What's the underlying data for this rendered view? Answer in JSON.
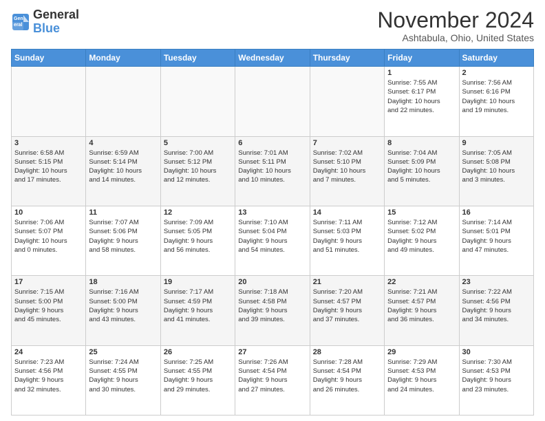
{
  "header": {
    "logo_line1": "General",
    "logo_line2": "Blue",
    "month": "November 2024",
    "location": "Ashtabula, Ohio, United States"
  },
  "weekdays": [
    "Sunday",
    "Monday",
    "Tuesday",
    "Wednesday",
    "Thursday",
    "Friday",
    "Saturday"
  ],
  "weeks": [
    [
      {
        "day": "",
        "info": ""
      },
      {
        "day": "",
        "info": ""
      },
      {
        "day": "",
        "info": ""
      },
      {
        "day": "",
        "info": ""
      },
      {
        "day": "",
        "info": ""
      },
      {
        "day": "1",
        "info": "Sunrise: 7:55 AM\nSunset: 6:17 PM\nDaylight: 10 hours\nand 22 minutes."
      },
      {
        "day": "2",
        "info": "Sunrise: 7:56 AM\nSunset: 6:16 PM\nDaylight: 10 hours\nand 19 minutes."
      }
    ],
    [
      {
        "day": "3",
        "info": "Sunrise: 6:58 AM\nSunset: 5:15 PM\nDaylight: 10 hours\nand 17 minutes."
      },
      {
        "day": "4",
        "info": "Sunrise: 6:59 AM\nSunset: 5:14 PM\nDaylight: 10 hours\nand 14 minutes."
      },
      {
        "day": "5",
        "info": "Sunrise: 7:00 AM\nSunset: 5:12 PM\nDaylight: 10 hours\nand 12 minutes."
      },
      {
        "day": "6",
        "info": "Sunrise: 7:01 AM\nSunset: 5:11 PM\nDaylight: 10 hours\nand 10 minutes."
      },
      {
        "day": "7",
        "info": "Sunrise: 7:02 AM\nSunset: 5:10 PM\nDaylight: 10 hours\nand 7 minutes."
      },
      {
        "day": "8",
        "info": "Sunrise: 7:04 AM\nSunset: 5:09 PM\nDaylight: 10 hours\nand 5 minutes."
      },
      {
        "day": "9",
        "info": "Sunrise: 7:05 AM\nSunset: 5:08 PM\nDaylight: 10 hours\nand 3 minutes."
      }
    ],
    [
      {
        "day": "10",
        "info": "Sunrise: 7:06 AM\nSunset: 5:07 PM\nDaylight: 10 hours\nand 0 minutes."
      },
      {
        "day": "11",
        "info": "Sunrise: 7:07 AM\nSunset: 5:06 PM\nDaylight: 9 hours\nand 58 minutes."
      },
      {
        "day": "12",
        "info": "Sunrise: 7:09 AM\nSunset: 5:05 PM\nDaylight: 9 hours\nand 56 minutes."
      },
      {
        "day": "13",
        "info": "Sunrise: 7:10 AM\nSunset: 5:04 PM\nDaylight: 9 hours\nand 54 minutes."
      },
      {
        "day": "14",
        "info": "Sunrise: 7:11 AM\nSunset: 5:03 PM\nDaylight: 9 hours\nand 51 minutes."
      },
      {
        "day": "15",
        "info": "Sunrise: 7:12 AM\nSunset: 5:02 PM\nDaylight: 9 hours\nand 49 minutes."
      },
      {
        "day": "16",
        "info": "Sunrise: 7:14 AM\nSunset: 5:01 PM\nDaylight: 9 hours\nand 47 minutes."
      }
    ],
    [
      {
        "day": "17",
        "info": "Sunrise: 7:15 AM\nSunset: 5:00 PM\nDaylight: 9 hours\nand 45 minutes."
      },
      {
        "day": "18",
        "info": "Sunrise: 7:16 AM\nSunset: 5:00 PM\nDaylight: 9 hours\nand 43 minutes."
      },
      {
        "day": "19",
        "info": "Sunrise: 7:17 AM\nSunset: 4:59 PM\nDaylight: 9 hours\nand 41 minutes."
      },
      {
        "day": "20",
        "info": "Sunrise: 7:18 AM\nSunset: 4:58 PM\nDaylight: 9 hours\nand 39 minutes."
      },
      {
        "day": "21",
        "info": "Sunrise: 7:20 AM\nSunset: 4:57 PM\nDaylight: 9 hours\nand 37 minutes."
      },
      {
        "day": "22",
        "info": "Sunrise: 7:21 AM\nSunset: 4:57 PM\nDaylight: 9 hours\nand 36 minutes."
      },
      {
        "day": "23",
        "info": "Sunrise: 7:22 AM\nSunset: 4:56 PM\nDaylight: 9 hours\nand 34 minutes."
      }
    ],
    [
      {
        "day": "24",
        "info": "Sunrise: 7:23 AM\nSunset: 4:56 PM\nDaylight: 9 hours\nand 32 minutes."
      },
      {
        "day": "25",
        "info": "Sunrise: 7:24 AM\nSunset: 4:55 PM\nDaylight: 9 hours\nand 30 minutes."
      },
      {
        "day": "26",
        "info": "Sunrise: 7:25 AM\nSunset: 4:55 PM\nDaylight: 9 hours\nand 29 minutes."
      },
      {
        "day": "27",
        "info": "Sunrise: 7:26 AM\nSunset: 4:54 PM\nDaylight: 9 hours\nand 27 minutes."
      },
      {
        "day": "28",
        "info": "Sunrise: 7:28 AM\nSunset: 4:54 PM\nDaylight: 9 hours\nand 26 minutes."
      },
      {
        "day": "29",
        "info": "Sunrise: 7:29 AM\nSunset: 4:53 PM\nDaylight: 9 hours\nand 24 minutes."
      },
      {
        "day": "30",
        "info": "Sunrise: 7:30 AM\nSunset: 4:53 PM\nDaylight: 9 hours\nand 23 minutes."
      }
    ]
  ]
}
